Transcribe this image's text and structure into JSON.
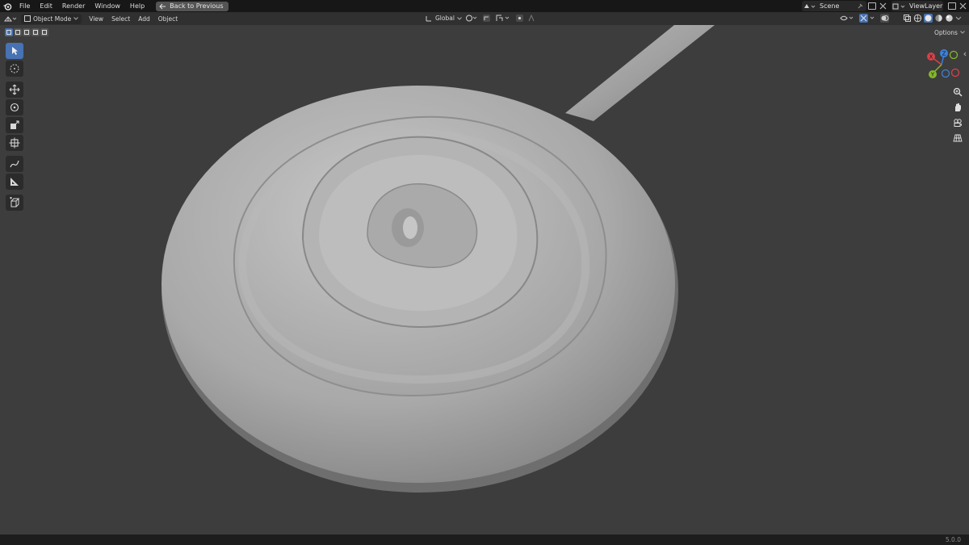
{
  "menubar": {
    "items": [
      "File",
      "Edit",
      "Render",
      "Window",
      "Help"
    ],
    "back_button": "Back to Previous",
    "scene_label": "Scene",
    "view_layer_label": "ViewLayer"
  },
  "header": {
    "mode": "Object Mode",
    "menus": [
      "View",
      "Select",
      "Add",
      "Object"
    ],
    "transform_orientation": "Global"
  },
  "viewport": {
    "options_label": "Options",
    "gizmo_axes": {
      "x": "X",
      "y": "Y",
      "z": "Z"
    },
    "colors": {
      "background": "#3d3d3d",
      "x_axis": "#d9414a",
      "y_axis": "#85b82a",
      "z_axis": "#3c81db",
      "active_tool": "#4772b3"
    }
  },
  "toolbar": {
    "tools": [
      "select-box",
      "cursor",
      "move",
      "rotate",
      "scale",
      "transform",
      "annotate",
      "measure",
      "add-cube"
    ]
  },
  "statusbar": {
    "version": "5.0.0"
  }
}
